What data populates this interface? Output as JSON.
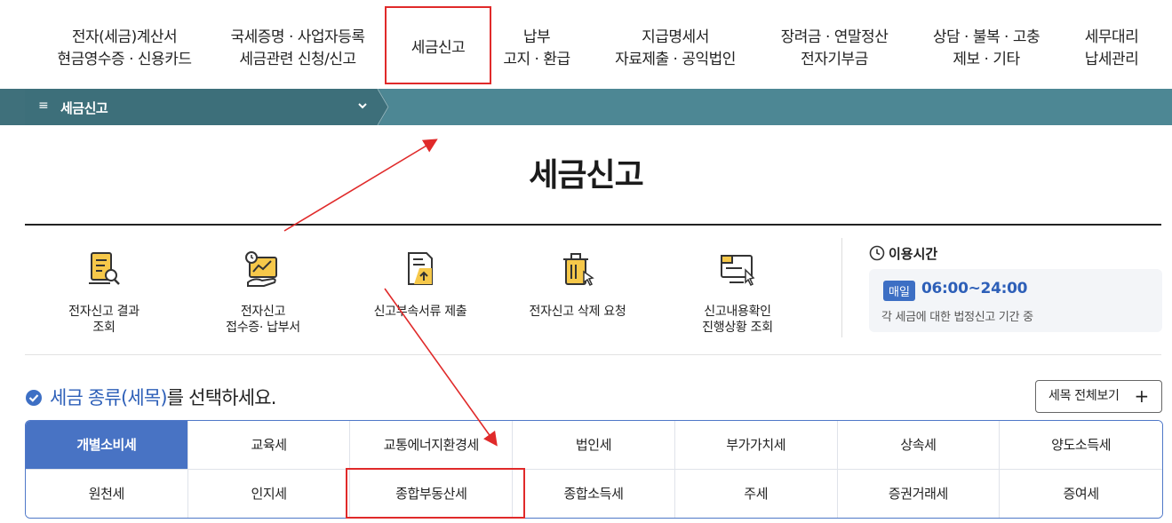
{
  "topnav": {
    "items": [
      {
        "line1": "전자(세금)계산서",
        "line2": "현금영수증 · 신용카드"
      },
      {
        "line1": "국세증명 · 사업자등록",
        "line2": "세금관련 신청/신고"
      },
      {
        "line1": "세금신고",
        "line2": ""
      },
      {
        "line1": "납부",
        "line2": "고지 · 환급"
      },
      {
        "line1": "지급명세서",
        "line2": "자료제출 · 공익법인"
      },
      {
        "line1": "장려금 · 연말정산",
        "line2": "전자기부금"
      },
      {
        "line1": "상담 · 불복 · 고충",
        "line2": "제보 · 기타"
      },
      {
        "line1": "세무대리",
        "line2": "납세관리"
      }
    ]
  },
  "subbar": {
    "menu_symbol": "≡",
    "crumb_label": "세금신고"
  },
  "page_title": "세금신고",
  "services": [
    {
      "line1": "전자신고 결과",
      "line2": "조회",
      "icon": "document-search-icon"
    },
    {
      "line1": "전자신고",
      "line2": "접수증· 납부서",
      "icon": "receipt-chart-icon"
    },
    {
      "line1": "신고부속서류 제출",
      "line2": "",
      "icon": "document-upload-icon"
    },
    {
      "line1": "전자신고 삭제 요청",
      "line2": "",
      "icon": "trash-click-icon"
    },
    {
      "line1": "신고내용확인",
      "line2": "진행상황 조회",
      "icon": "monitor-cursor-icon"
    }
  ],
  "hours": {
    "title": "이용시간",
    "badge": "매일",
    "time": "06:00~24:00",
    "note": "각 세금에 대한 법정신고 기간 중"
  },
  "select": {
    "title_highlight": "세금 종류(세목)",
    "title_rest": "를 선택하세요.",
    "all_button": "세목 전체보기",
    "all_button_symbol": "+"
  },
  "tax_types": {
    "row1": [
      "개별소비세",
      "교육세",
      "교통에너지환경세",
      "법인세",
      "부가가치세",
      "상속세",
      "양도소득세"
    ],
    "row2": [
      "원천세",
      "인지세",
      "종합부동산세",
      "종합소득세",
      "주세",
      "증권거래세",
      "증여세"
    ]
  },
  "colors": {
    "subbar": "#4d8794",
    "accent_blue": "#4873c4",
    "annotation_red": "#e02a2a"
  }
}
